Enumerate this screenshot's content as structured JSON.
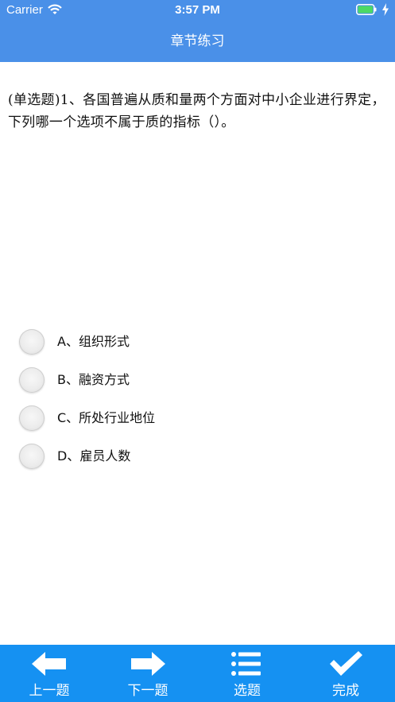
{
  "status_bar": {
    "carrier": "Carrier",
    "time": "3:57 PM",
    "wifi_icon": "wifi-icon",
    "battery_icon": "battery-icon",
    "battery_level": 1.0,
    "battery_color": "#4cd964"
  },
  "nav": {
    "title": "章节练习",
    "background": "#4a90e8"
  },
  "question": {
    "text": "(单选题)1、各国普遍从质和量两个方面对中小企业进行界定，下列哪一个选项不属于质的指标（）。"
  },
  "options": [
    {
      "label": "A、组织形式",
      "selected": false
    },
    {
      "label": "B、融资方式",
      "selected": false
    },
    {
      "label": "C、所处行业地位",
      "selected": false
    },
    {
      "label": "D、雇员人数",
      "selected": false
    }
  ],
  "tab_bar": {
    "background": "#1591f2",
    "tabs": [
      {
        "label": "上一题",
        "icon": "arrow-left-icon"
      },
      {
        "label": "下一题",
        "icon": "arrow-right-icon"
      },
      {
        "label": "选题",
        "icon": "list-icon"
      },
      {
        "label": "完成",
        "icon": "checkmark-icon"
      }
    ]
  }
}
